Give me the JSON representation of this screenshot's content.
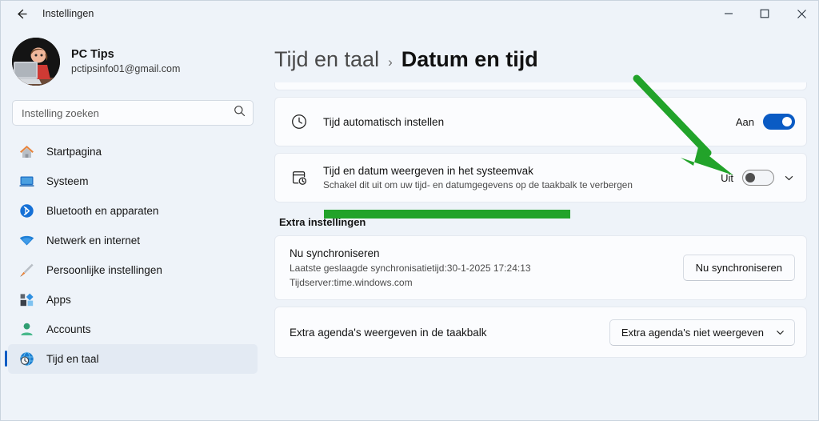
{
  "window": {
    "title": "Instellingen",
    "back_icon": "back-arrow-icon",
    "minimize_label": "–",
    "maximize_label": "□",
    "close_label": "✕"
  },
  "account": {
    "name": "PC Tips",
    "email": "pctipsinfo01@gmail.com"
  },
  "search": {
    "placeholder": "Instelling zoeken",
    "value": "",
    "icon": "search-icon"
  },
  "sidebar": {
    "items": [
      {
        "label": "Startpagina",
        "icon": "home-icon",
        "selected": false
      },
      {
        "label": "Systeem",
        "icon": "monitor-icon",
        "selected": false
      },
      {
        "label": "Bluetooth en apparaten",
        "icon": "bluetooth-icon",
        "selected": false
      },
      {
        "label": "Netwerk en internet",
        "icon": "wifi-icon",
        "selected": false
      },
      {
        "label": "Persoonlijke instellingen",
        "icon": "brush-icon",
        "selected": false
      },
      {
        "label": "Apps",
        "icon": "apps-icon",
        "selected": false
      },
      {
        "label": "Accounts",
        "icon": "person-icon",
        "selected": false
      },
      {
        "label": "Tijd en taal",
        "icon": "globe-clock-icon",
        "selected": true
      }
    ]
  },
  "breadcrumb": {
    "parent": "Tijd en taal",
    "separator": "›",
    "current": "Datum en tijd"
  },
  "settings": {
    "auto_time": {
      "title": "Tijd automatisch instellen",
      "icon": "clock-icon",
      "toggle_label": "Aan",
      "toggle_state": "on"
    },
    "systray_time": {
      "title": "Tijd en datum weergeven in het systeemvak",
      "subtitle": "Schakel dit uit om uw tijd- en datumgegevens op de taakbalk te verbergen",
      "icon": "calendar-clock-icon",
      "toggle_label": "Uit",
      "toggle_state": "off",
      "expand_icon": "chevron-down-icon"
    }
  },
  "extra": {
    "heading": "Extra instellingen",
    "sync": {
      "title": "Nu synchroniseren",
      "last_sync": "Laatste geslaagde synchronisatietijd:30-1-2025 17:24:13",
      "time_server": "Tijdserver:time.windows.com",
      "button_label": "Nu synchroniseren"
    },
    "calendars": {
      "label": "Extra agenda's weergeven in de taakbalk",
      "dropdown_value": "Extra agenda's niet weergeven",
      "dropdown_icon": "chevron-down-icon"
    }
  },
  "annotations": {
    "arrow_color": "#22a32a",
    "highlight_color": "#22a32a"
  }
}
